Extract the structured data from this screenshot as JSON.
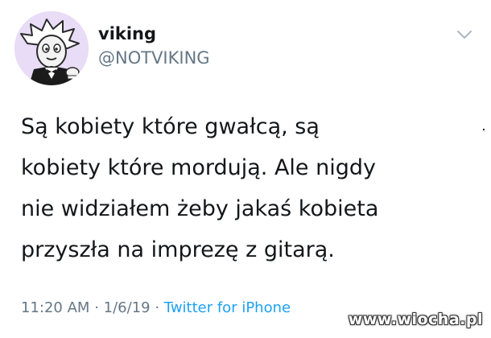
{
  "author": {
    "display_name": "viking",
    "handle": "@NOTVIKING"
  },
  "tweet": {
    "lines": [
      "Są kobiety które gwałcą, są",
      "kobiety które mordują. Ale nigdy",
      "nie widziałem żeby jakaś kobieta",
      "przyszła na imprezę z gitarą."
    ],
    "time": "11:20 AM",
    "date": "1/6/19",
    "separator": "·",
    "source": "Twitter for iPhone"
  },
  "watermark": "www.wiocha.pl",
  "icons": {
    "avatar": "cartoon-avatar-icon",
    "menu": "chevron-down-icon"
  },
  "colors": {
    "text": "#14171a",
    "secondary": "#657786",
    "link": "#1da1f2",
    "avatar_bg": "#e8dcf6"
  }
}
